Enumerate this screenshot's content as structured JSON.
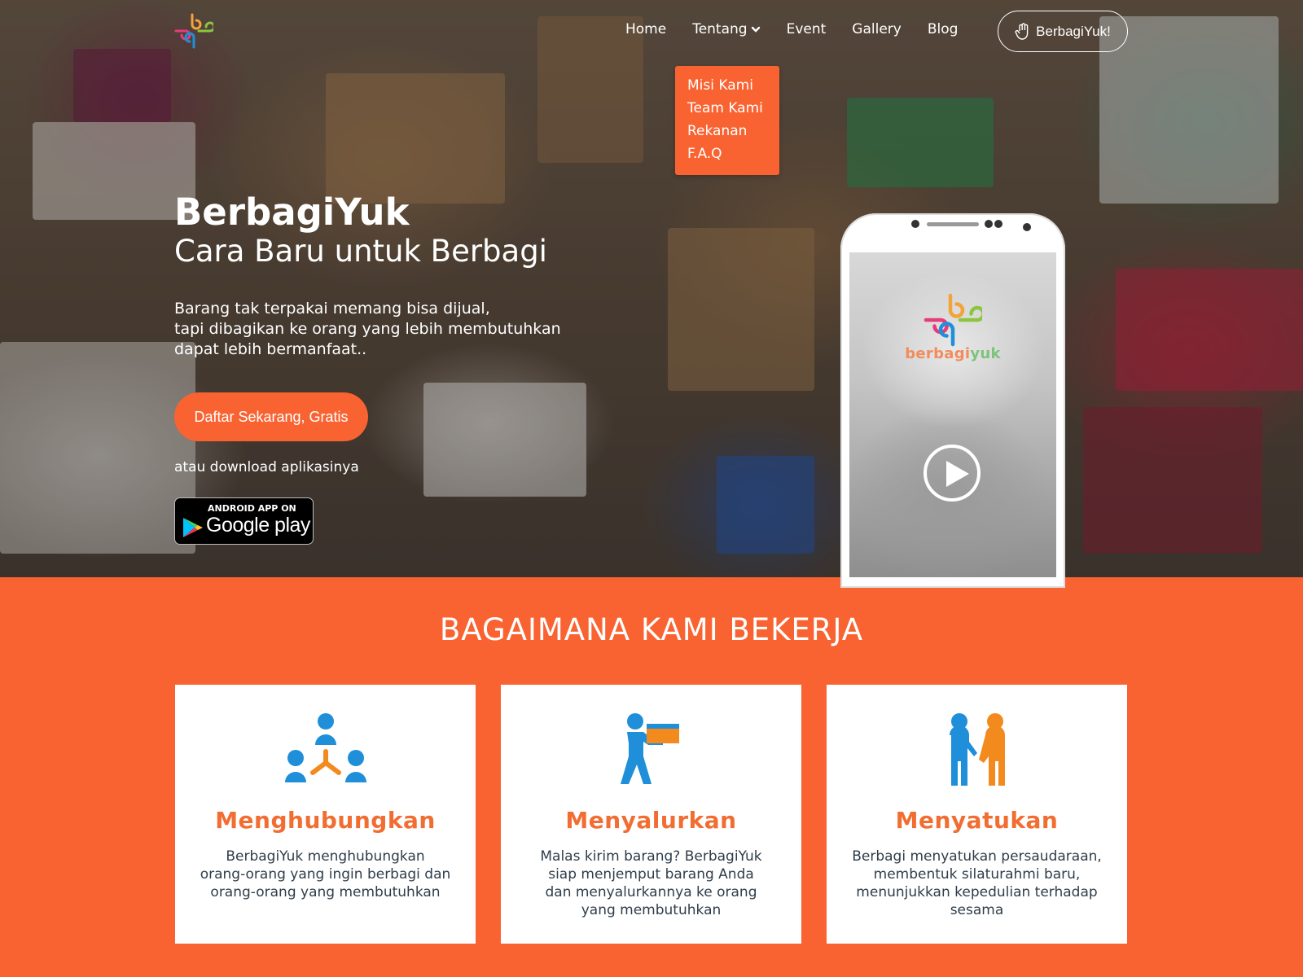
{
  "nav": {
    "items": [
      "Home",
      "Tentang",
      "Event",
      "Gallery",
      "Blog"
    ],
    "cta": "BerbagiYuk!",
    "dropdown": [
      "Misi Kami",
      "Team Kami",
      "Rekanan",
      "F.A.Q"
    ]
  },
  "hero": {
    "title": "BerbagiYuk",
    "subtitle": "Cara Baru untuk Berbagi",
    "description": [
      "Barang tak terpakai memang bisa dijual,",
      "tapi dibagikan ke orang yang lebih membutuhkan",
      "dapat lebih bermanfaat.."
    ],
    "signup_button": "Daftar Sekarang, Gratis",
    "download_text": "atau download aplikasinya",
    "play_badge_small": "ANDROID APP ON",
    "play_badge_big": "Google play",
    "phone_brand_1": "berbagi",
    "phone_brand_2": "yuk"
  },
  "how": {
    "title": "BAGAIMANA KAMI BEKERJA",
    "cards": [
      {
        "icon": "network-people-icon",
        "title": "Menghubungkan",
        "lines": [
          "BerbagiYuk menghubungkan",
          "orang-orang yang ingin berbagi dan",
          "orang-orang yang membutuhkan"
        ]
      },
      {
        "icon": "delivery-person-icon",
        "title": "Menyalurkan",
        "lines": [
          "Malas kirim barang? BerbagiYuk",
          "siap menjemput barang Anda",
          "dan menyalurkannya ke orang",
          "yang membutuhkan"
        ]
      },
      {
        "icon": "handshake-people-icon",
        "title": "Menyatukan",
        "lines": [
          "Berbagi menyatukan persaudaraan,",
          "membentuk silaturahmi baru,",
          "menunjukkan kepedulian terhadap",
          "sesama"
        ]
      }
    ]
  },
  "colors": {
    "accent": "#f96332",
    "title_orange": "#f26d31",
    "icon_blue": "#1e8fd8",
    "icon_orange": "#f28a1e"
  }
}
